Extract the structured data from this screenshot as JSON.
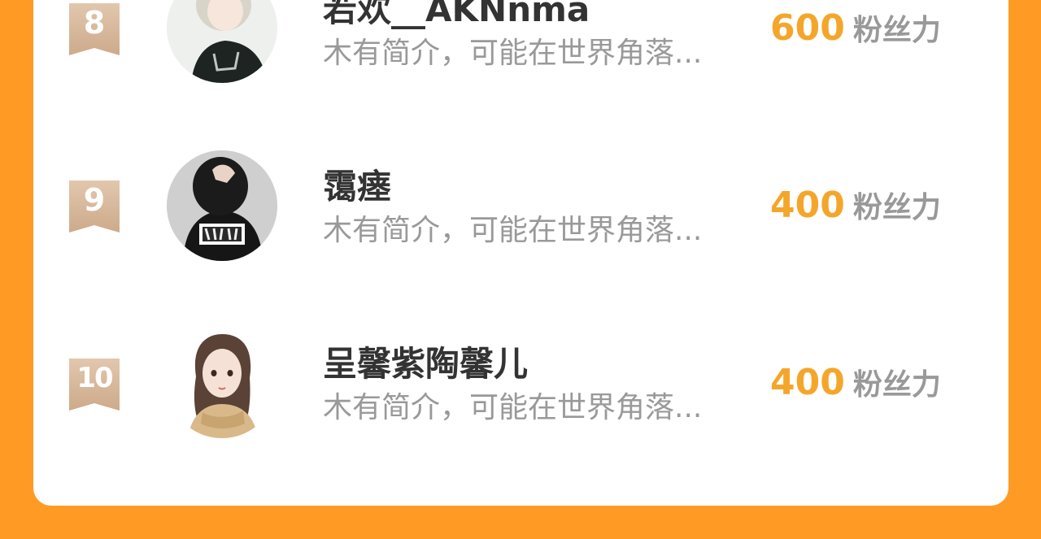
{
  "colors": {
    "background": "#FF9B24",
    "card": "#FFFFFF",
    "fans_number": "#F4A62A",
    "rank_badge": "#D6B89C"
  },
  "ranking": [
    {
      "rank": "8",
      "name": "若欢__AKNnma",
      "bio": "木有简介，可能在世界角落...",
      "fans": "600",
      "fans_label": "粉丝力",
      "avatar_icon": "anime-boy-avatar"
    },
    {
      "rank": "9",
      "name": "霭瘗",
      "bio": "木有简介，可能在世界角落...",
      "fans": "400",
      "fans_label": "粉丝力",
      "avatar_icon": "dark-hoodie-avatar"
    },
    {
      "rank": "10",
      "name": "呈馨紫陶馨儿",
      "bio": "木有简介，可能在世界角落...",
      "fans": "400",
      "fans_label": "粉丝力",
      "avatar_icon": "anime-girl-avatar"
    }
  ]
}
